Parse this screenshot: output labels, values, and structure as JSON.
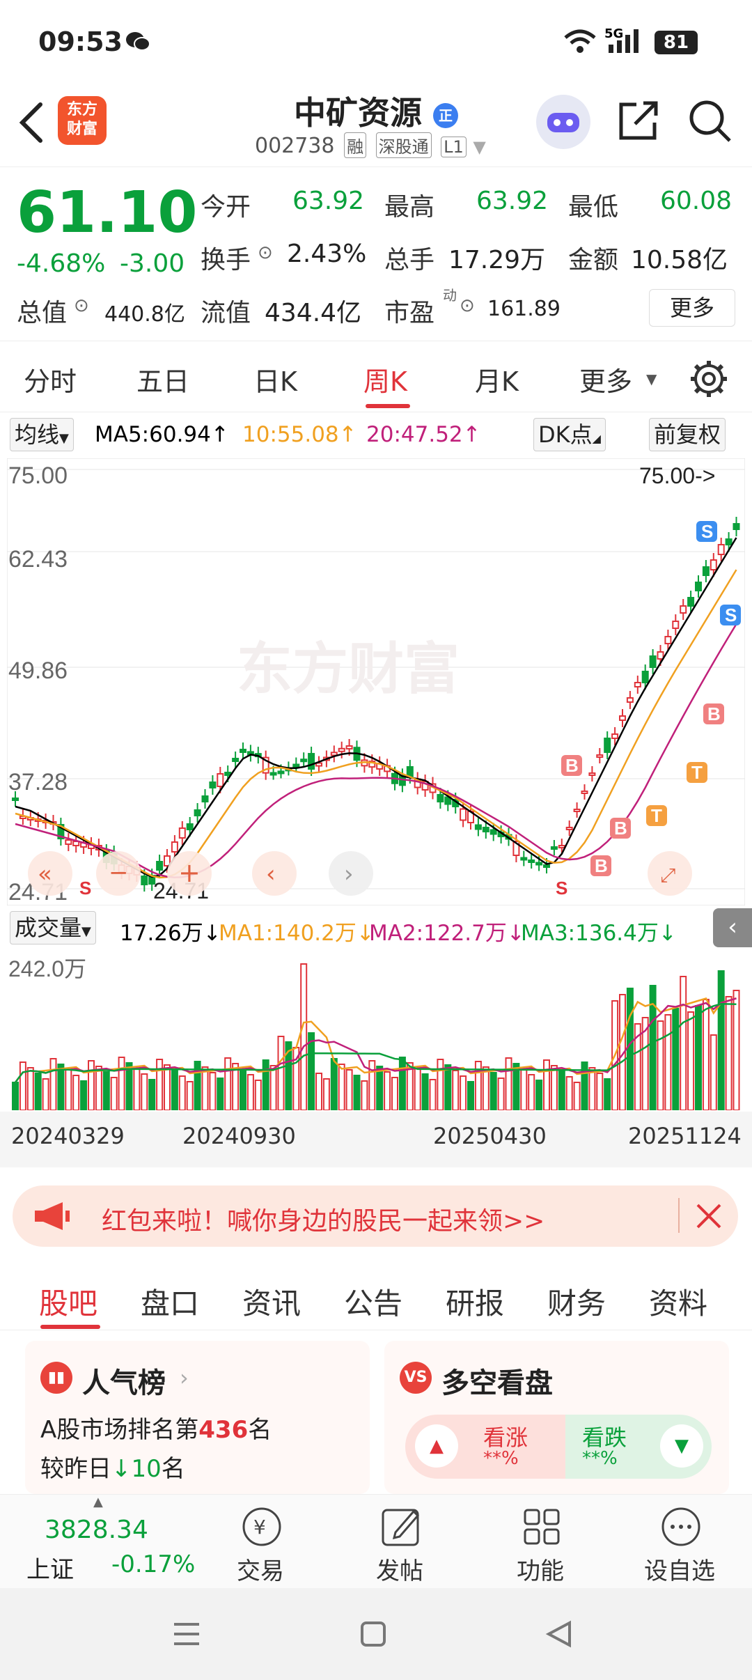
{
  "status": {
    "time": "09:53",
    "net": "5G",
    "battery": "81"
  },
  "header": {
    "logo_line1": "东方",
    "logo_line2": "财富",
    "name": "中矿资源",
    "badge": "正",
    "code": "002738",
    "tags": [
      "融",
      "深股通",
      "L1"
    ]
  },
  "quote": {
    "price": "61.10",
    "change_pct": "-4.68%",
    "change": "-3.00",
    "open_label": "今开",
    "open": "63.92",
    "high_label": "最高",
    "high": "63.92",
    "low_label": "最低",
    "low": "60.08",
    "turnover_label": "换手",
    "turnover": "2.43%",
    "volume_label": "总手",
    "volume": "17.29万",
    "amount_label": "金额",
    "amount": "10.58亿",
    "mktcap_label": "总值",
    "mktcap": "440.8亿",
    "float_label": "流值",
    "float": "434.4亿",
    "pe_label": "市盈",
    "pe_sup": "动",
    "pe": "161.89",
    "more": "更多"
  },
  "ktabs": {
    "t1": "分时",
    "t2": "五日",
    "t3": "日K",
    "t4": "周K",
    "t5": "月K",
    "t6": "更多"
  },
  "mabar": {
    "ma_sel": "均线",
    "ma5": "MA5:60.94↑",
    "ma10": "10:55.08↑",
    "ma20": "20:47.52↑",
    "dk": "DK点",
    "fq": "前复权"
  },
  "chart": {
    "y1": "75.00",
    "y2": "62.43",
    "y3": "49.86",
    "y4": "37.28",
    "y5": "24.71",
    "max_note": "75.00->",
    "min_note": "24.71",
    "watermark": "东方财富"
  },
  "volbar": {
    "sel": "成交量",
    "vol": "17.26万↓",
    "ma1": "MA1:140.2万↓",
    "ma2": "MA2:122.7万↓",
    "ma3": "MA3:136.4万↓",
    "max": "242.0万"
  },
  "dates": {
    "d1": "20240329",
    "d2": "20240930",
    "d3": "20250430",
    "d4": "20251124"
  },
  "banner": {
    "text": "红包来啦！喊你身边的股民一起来领>>"
  },
  "btabs": {
    "t1": "股吧",
    "t2": "盘口",
    "t3": "资讯",
    "t4": "公告",
    "t5": "研报",
    "t6": "财务",
    "t7": "资料"
  },
  "card1": {
    "title": "人气榜",
    "line1_pre": "A股市场排名第",
    "rank": "436",
    "line1_post": "名",
    "line2_pre": "较昨日",
    "delta": "10",
    "line2_post": "名"
  },
  "card2": {
    "title": "多空看盘",
    "up": "看涨",
    "up_val": "**%",
    "down": "看跌",
    "down_val": "**%"
  },
  "bnav": {
    "index_val": "3828.34",
    "index_name": "上证",
    "index_chg": "-0.17%",
    "n1": "交易",
    "n2": "发帖",
    "n3": "功能",
    "n4": "设自选"
  },
  "colors": {
    "up": "#e0333a",
    "down": "#0aa03b",
    "ma5": "#000000",
    "ma10": "#f0a020",
    "ma20": "#c0207a"
  }
}
